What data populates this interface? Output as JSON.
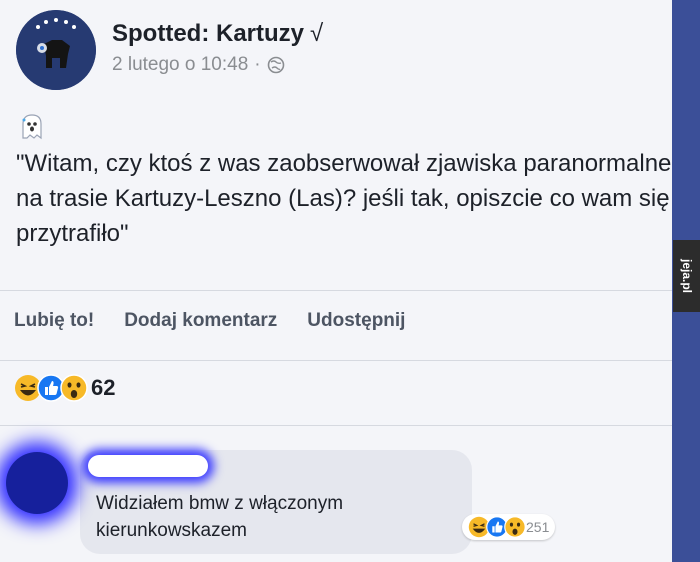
{
  "post": {
    "page_name": "Spotted: Kartuzy",
    "verified_mark": "√",
    "timestamp": "2 lutego o 10:48",
    "separator": "·",
    "audience_icon": "globe-icon",
    "emoji": "ghost-emoji",
    "text": "\"Witam, czy ktoś z was zaobserwował zjawiska paranormalne na trasie Kartuzy-Leszno (Las)? jeśli tak, opiszcie co wam się przytrafiło\""
  },
  "actions": {
    "like": "Lubię to!",
    "comment": "Dodaj komentarz",
    "share": "Udostępnij"
  },
  "reactions": {
    "icons": [
      "haha-icon",
      "like-icon",
      "wow-icon"
    ],
    "count": "62"
  },
  "comment": {
    "text": "Widziałem bmw z włączonym kierunkowskazem",
    "reaction_icons": [
      "haha-icon",
      "like-icon",
      "wow-icon"
    ],
    "reaction_count": "251"
  },
  "watermark": {
    "text": "jeja.pl"
  },
  "colors": {
    "background": "#3b4f98",
    "card": "#f4f5f9",
    "text": "#1d2129",
    "muted": "#8a8d91",
    "like_blue": "#1877f2",
    "emoji_yellow": "#f7b928"
  }
}
